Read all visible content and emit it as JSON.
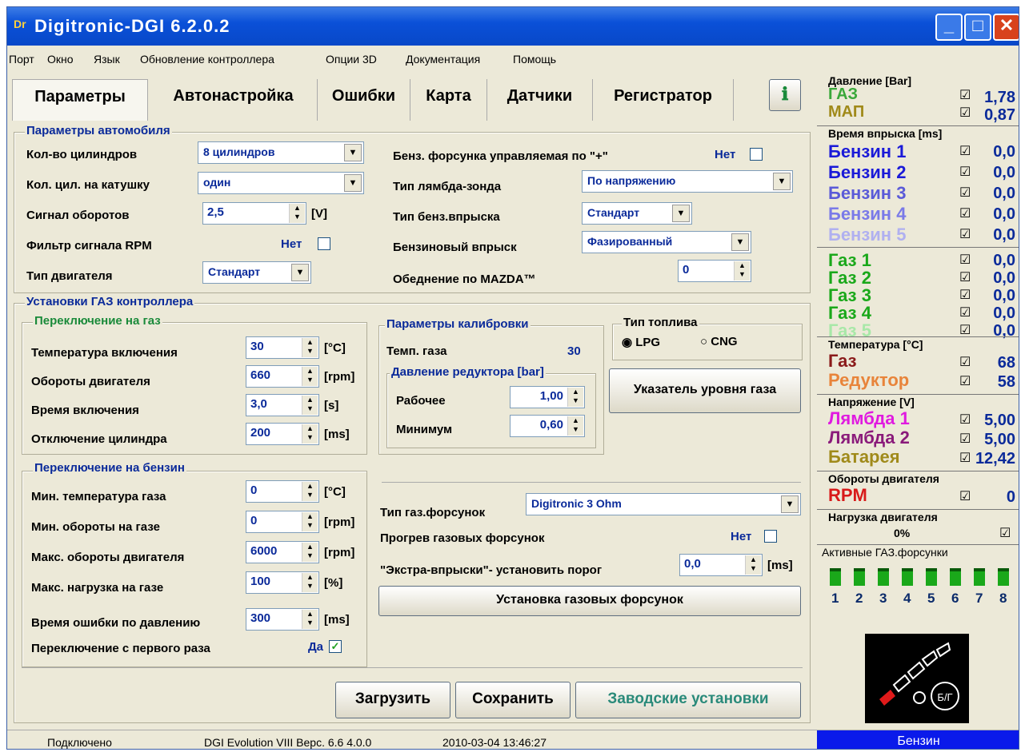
{
  "window": {
    "title": "Digitronic-DGI  6.2.0.2",
    "app_icon": "Dr"
  },
  "menu": [
    "Порт",
    "Окно",
    "Язык",
    "Обновление контроллера",
    "Опции 3D",
    "Документация",
    "Помощь"
  ],
  "tabs": [
    "Параметры",
    "Автонастройка",
    "Ошибки",
    "Карта",
    "Датчики",
    "Регистратор"
  ],
  "car": {
    "legend": "Параметры автомобиля",
    "cyl_label": "Кол-во цилиндров",
    "cyl_value": "8 цилиндров",
    "coil_label": "Кол. цил. на катушку",
    "coil_value": "один",
    "rpm_sig_label": "Сигнал оборотов",
    "rpm_sig_value": "2,5",
    "rpm_sig_unit": "[V]",
    "rpm_filter_label": "Фильтр сигнала RPM",
    "rpm_filter_value": "Нет",
    "engine_label": "Тип двигателя",
    "engine_value": "Стандарт",
    "petrol_inj_label": "Бенз. форсунка управляемая по \"+\"",
    "petrol_inj_value": "Нет",
    "lambda_label": "Тип лямбда-зонда",
    "lambda_value": "По напряжению",
    "petrol_type_label": "Тип бенз.впрыска",
    "petrol_type_value": "Стандарт",
    "petrol_mode_label": "Бензиновый впрыск",
    "petrol_mode_value": "Фазированный",
    "mazda_label": "Обеднение по MAZDA™",
    "mazda_value": "0"
  },
  "gas": {
    "legend": "Установки ГАЗ контроллера",
    "to_gas_legend": "Переключение на газ",
    "rows": [
      {
        "label": "Температура включения",
        "value": "30",
        "unit": "[°C]"
      },
      {
        "label": "Обороты двигателя",
        "value": "660",
        "unit": "[rpm]"
      },
      {
        "label": "Время включения",
        "value": "3,0",
        "unit": "[s]"
      },
      {
        "label": "Отключение цилиндра",
        "value": "200",
        "unit": "[ms]"
      }
    ],
    "to_petrol_legend": "Переключение на бензин",
    "prow": [
      {
        "label": "Мин. температура газа",
        "value": "0",
        "unit": "[°C]"
      },
      {
        "label": "Мин. обороты на газе",
        "value": "0",
        "unit": "[rpm]"
      },
      {
        "label": "Макс. обороты двигателя",
        "value": "6000",
        "unit": "[rpm]"
      },
      {
        "label": "Макс. нагрузка на газе",
        "value": "100",
        "unit": "[%]"
      }
    ],
    "err_label": "Время ошибки по давлению",
    "err_value": "300",
    "err_unit": "[ms]",
    "first_label": "Переключение с первого раза",
    "first_value": "Да",
    "calib_legend": "Параметры калибровки",
    "gas_temp_label": "Темп. газа",
    "gas_temp_value": "30",
    "press_legend": "Давление редуктора [bar]",
    "work_label": "Рабочее",
    "work_value": "1,00",
    "min_label": "Минимум",
    "min_value": "0,60",
    "fuel_legend": "Тип топлива",
    "lpg": "LPG",
    "cng": "CNG",
    "level_btn": "Указатель уровня газа",
    "inj_label": "Тип газ.форсунок",
    "inj_value": "Digitronic 3 Ohm",
    "warm_label": "Прогрев газовых форсунок",
    "warm_value": "Нет",
    "extra_label": "\"Экстра-впрыски\"- установить порог",
    "extra_value": "0,0",
    "extra_unit": "[ms]",
    "setup_btn": "Установка газовых форсунок"
  },
  "buttons": {
    "load": "Загрузить",
    "save": "Сохранить",
    "factory": "Заводские установки"
  },
  "right": {
    "press_h": "Давление [Bar]",
    "gas": "ГАЗ",
    "gas_v": "1,78",
    "map": "МАП",
    "map_v": "0,87",
    "inj_h": "Время впрыска [ms]",
    "petrol": [
      {
        "n": "Бензин 1",
        "v": "0,0"
      },
      {
        "n": "Бензин 2",
        "v": "0,0"
      },
      {
        "n": "Бензин 3",
        "v": "0,0"
      },
      {
        "n": "Бензин 4",
        "v": "0,0"
      },
      {
        "n": "Бензин 5",
        "v": "0,0"
      }
    ],
    "gasr": [
      {
        "n": "Газ 1",
        "v": "0,0"
      },
      {
        "n": "Газ 2",
        "v": "0,0"
      },
      {
        "n": "Газ 3",
        "v": "0,0"
      },
      {
        "n": "Газ 4",
        "v": "0,0"
      },
      {
        "n": "Газ 5",
        "v": "0,0"
      }
    ],
    "temp_h": "Температура  [°C]",
    "t_gas": "Газ",
    "t_gas_v": "68",
    "t_red": "Редуктор",
    "t_red_v": "58",
    "volt_h": "Напряжение [V]",
    "l1": "Лямбда 1",
    "l1_v": "5,00",
    "l2": "Лямбда 2",
    "l2_v": "5,00",
    "bat": "Батарея",
    "bat_v": "12,42",
    "rpm_h": "Обороты двигателя",
    "rpm": "RPM",
    "rpm_v": "0",
    "load_h": "Нагрузка двигателя",
    "load_v": "0%",
    "active_h": "Активные ГАЗ.форсунки",
    "injectors": [
      "1",
      "2",
      "3",
      "4",
      "5",
      "6",
      "7",
      "8"
    ],
    "switch_label": "Б/Г",
    "mode": "Бензин"
  },
  "status": {
    "conn": "Подключено",
    "ecu": "DGI Evolution VIII  Верс. 6.6  4.0.0",
    "date": "2010-03-04 13:46:27"
  }
}
